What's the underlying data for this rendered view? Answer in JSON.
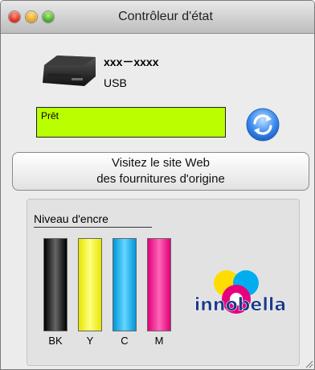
{
  "window": {
    "title": "Contrôleur d'état"
  },
  "device": {
    "model": "xxx－xxxx",
    "interface": "USB"
  },
  "status": {
    "text": "Prêt",
    "color": "#baff00"
  },
  "buttons": {
    "website_line1": "Visitez le site Web",
    "website_line2": "des fournitures d'origine"
  },
  "ink": {
    "label": "Niveau d'encre",
    "cartridges": [
      {
        "name": "BK",
        "color": "#111111",
        "level": 1.0
      },
      {
        "name": "Y",
        "color": "#ffff00",
        "level": 1.0
      },
      {
        "name": "C",
        "color": "#00b4f0",
        "level": 1.0
      },
      {
        "name": "M",
        "color": "#ff0090",
        "level": 1.0
      }
    ]
  },
  "brand": {
    "logo_text": "innobella"
  }
}
